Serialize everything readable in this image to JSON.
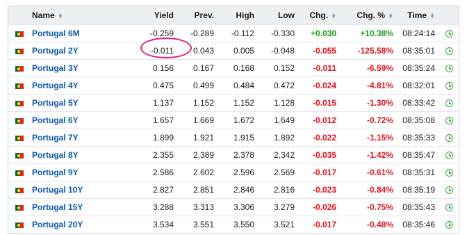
{
  "headers": {
    "name": "Name",
    "yield": "Yield",
    "prev": "Prev.",
    "high": "High",
    "low": "Low",
    "chg": "Chg.",
    "chg_pct": "Chg. %",
    "time": "Time"
  },
  "flag_icon": "portugal-flag-icon",
  "clock_icon": "clock-icon",
  "colors": {
    "positive": "#1e9b1e",
    "negative": "#e0141e",
    "link": "#0a59a8",
    "annotation": "#e0207a"
  },
  "rows": [
    {
      "name": "Portugal 6M",
      "yield": "-0.259",
      "prev": "-0.289",
      "high": "-0.112",
      "low": "-0.330",
      "chg": "+0.030",
      "chg_pct": "+10.38%",
      "time": "08:24:14",
      "dir": "pos"
    },
    {
      "name": "Portugal 2Y",
      "yield": "-0.011",
      "prev": "0.043",
      "high": "0.005",
      "low": "-0.048",
      "chg": "-0.055",
      "chg_pct": "-125.58%",
      "time": "08:35:01",
      "dir": "neg"
    },
    {
      "name": "Portugal 3Y",
      "yield": "0.156",
      "prev": "0.167",
      "high": "0.168",
      "low": "0.152",
      "chg": "-0.011",
      "chg_pct": "-6.59%",
      "time": "08:35:24",
      "dir": "neg"
    },
    {
      "name": "Portugal 4Y",
      "yield": "0.475",
      "prev": "0.499",
      "high": "0.484",
      "low": "0.472",
      "chg": "-0.024",
      "chg_pct": "-4.81%",
      "time": "08:32:01",
      "dir": "neg"
    },
    {
      "name": "Portugal 5Y",
      "yield": "1.137",
      "prev": "1.152",
      "high": "1.152",
      "low": "1.128",
      "chg": "-0.015",
      "chg_pct": "-1.30%",
      "time": "08:33:42",
      "dir": "neg"
    },
    {
      "name": "Portugal 6Y",
      "yield": "1.657",
      "prev": "1.669",
      "high": "1.672",
      "low": "1.649",
      "chg": "-0.012",
      "chg_pct": "-0.72%",
      "time": "08:35:08",
      "dir": "neg"
    },
    {
      "name": "Portugal 7Y",
      "yield": "1.899",
      "prev": "1.921",
      "high": "1.915",
      "low": "1.892",
      "chg": "-0.022",
      "chg_pct": "-1.15%",
      "time": "08:35:33",
      "dir": "neg"
    },
    {
      "name": "Portugal 8Y",
      "yield": "2.355",
      "prev": "2.389",
      "high": "2.378",
      "low": "2.342",
      "chg": "-0.035",
      "chg_pct": "-1.42%",
      "time": "08:35:47",
      "dir": "neg"
    },
    {
      "name": "Portugal 9Y",
      "yield": "2.586",
      "prev": "2.602",
      "high": "2.596",
      "low": "2.569",
      "chg": "-0.017",
      "chg_pct": "-0.61%",
      "time": "08:35:31",
      "dir": "neg"
    },
    {
      "name": "Portugal 10Y",
      "yield": "2.827",
      "prev": "2.851",
      "high": "2.846",
      "low": "2.816",
      "chg": "-0.023",
      "chg_pct": "-0.84%",
      "time": "08:35:19",
      "dir": "neg"
    },
    {
      "name": "Portugal 15Y",
      "yield": "3.288",
      "prev": "3.313",
      "high": "3.306",
      "low": "3.279",
      "chg": "-0.026",
      "chg_pct": "-0.75%",
      "time": "08:35:43",
      "dir": "neg"
    },
    {
      "name": "Portugal 20Y",
      "yield": "3.534",
      "prev": "3.551",
      "high": "3.550",
      "low": "3.521",
      "chg": "-0.017",
      "chg_pct": "-0.48%",
      "time": "08:35:46",
      "dir": "neg"
    }
  ]
}
